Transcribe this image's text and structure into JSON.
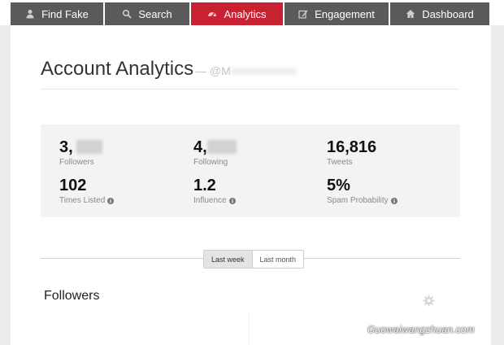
{
  "nav": {
    "tabs": [
      {
        "label": "Find Fake",
        "icon": "user-icon",
        "active": false
      },
      {
        "label": "Search",
        "icon": "search-icon",
        "active": false
      },
      {
        "label": "Analytics",
        "icon": "dashboard-gauge-icon",
        "active": true
      },
      {
        "label": "Engagement",
        "icon": "edit-icon",
        "active": false
      },
      {
        "label": "Dashboard",
        "icon": "home-icon",
        "active": false
      }
    ]
  },
  "page": {
    "title": "Account Analytics",
    "handle": "— @M"
  },
  "stats": {
    "followers": {
      "value": "3,",
      "label": "Followers"
    },
    "following": {
      "value": "4,",
      "label": "Following"
    },
    "tweets": {
      "value": "16,816",
      "label": "Tweets"
    },
    "times_listed": {
      "value": "102",
      "label": "Times Listed"
    },
    "influence": {
      "value": "1.2",
      "label": "Influence"
    },
    "spam_probability": {
      "value": "5%",
      "label": "Spam Probability"
    }
  },
  "range": {
    "options": [
      "Last week",
      "Last month"
    ],
    "selected": "Last week"
  },
  "section": {
    "title": "Followers"
  },
  "watermark": "Guowaiwangzhuan.com",
  "colors": {
    "nav_bg": "#5a5a5a",
    "nav_active": "#c82132",
    "frame_bg": "#ececec",
    "stats_bg": "#f3f3f3"
  }
}
